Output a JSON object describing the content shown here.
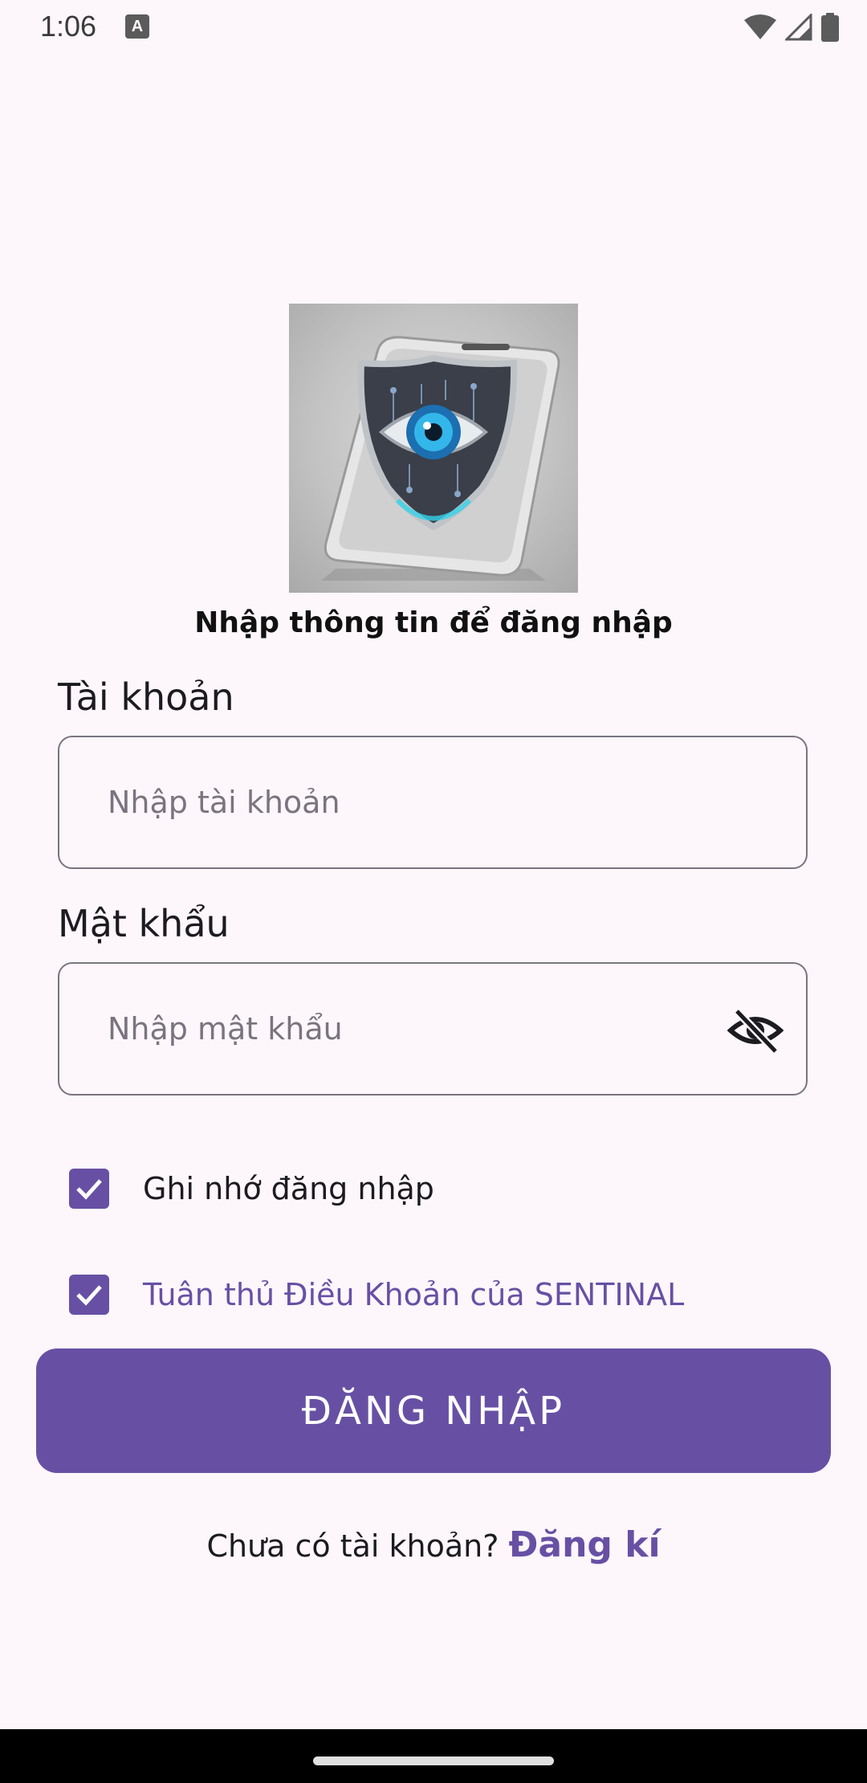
{
  "status_bar": {
    "time": "1:06",
    "notification_glyph": "A",
    "icons": [
      "wifi-icon",
      "signal-icon",
      "battery-icon"
    ]
  },
  "hero": {
    "icon": "shield-eye-phone-logo"
  },
  "title": "Nhập thông tin để đăng nhập",
  "account": {
    "label": "Tài khoản",
    "value": "",
    "placeholder": "Nhập tài khoản"
  },
  "password": {
    "label": "Mật khẩu",
    "value": "",
    "placeholder": "Nhập mật khẩu",
    "toggle_icon": "eye-off-icon"
  },
  "remember": {
    "label": "Ghi nhớ đăng nhập",
    "checked": true
  },
  "terms": {
    "label": "Tuân thủ Điều Khoản của SENTINAL",
    "checked": true
  },
  "login_button": "ĐĂNG NHẬP",
  "signup": {
    "prompt": "Chưa có tài khoản? ",
    "link": "Đăng kí"
  },
  "colors": {
    "accent": "#6750a4",
    "background": "#fdf7fc",
    "outline": "#79747e"
  }
}
